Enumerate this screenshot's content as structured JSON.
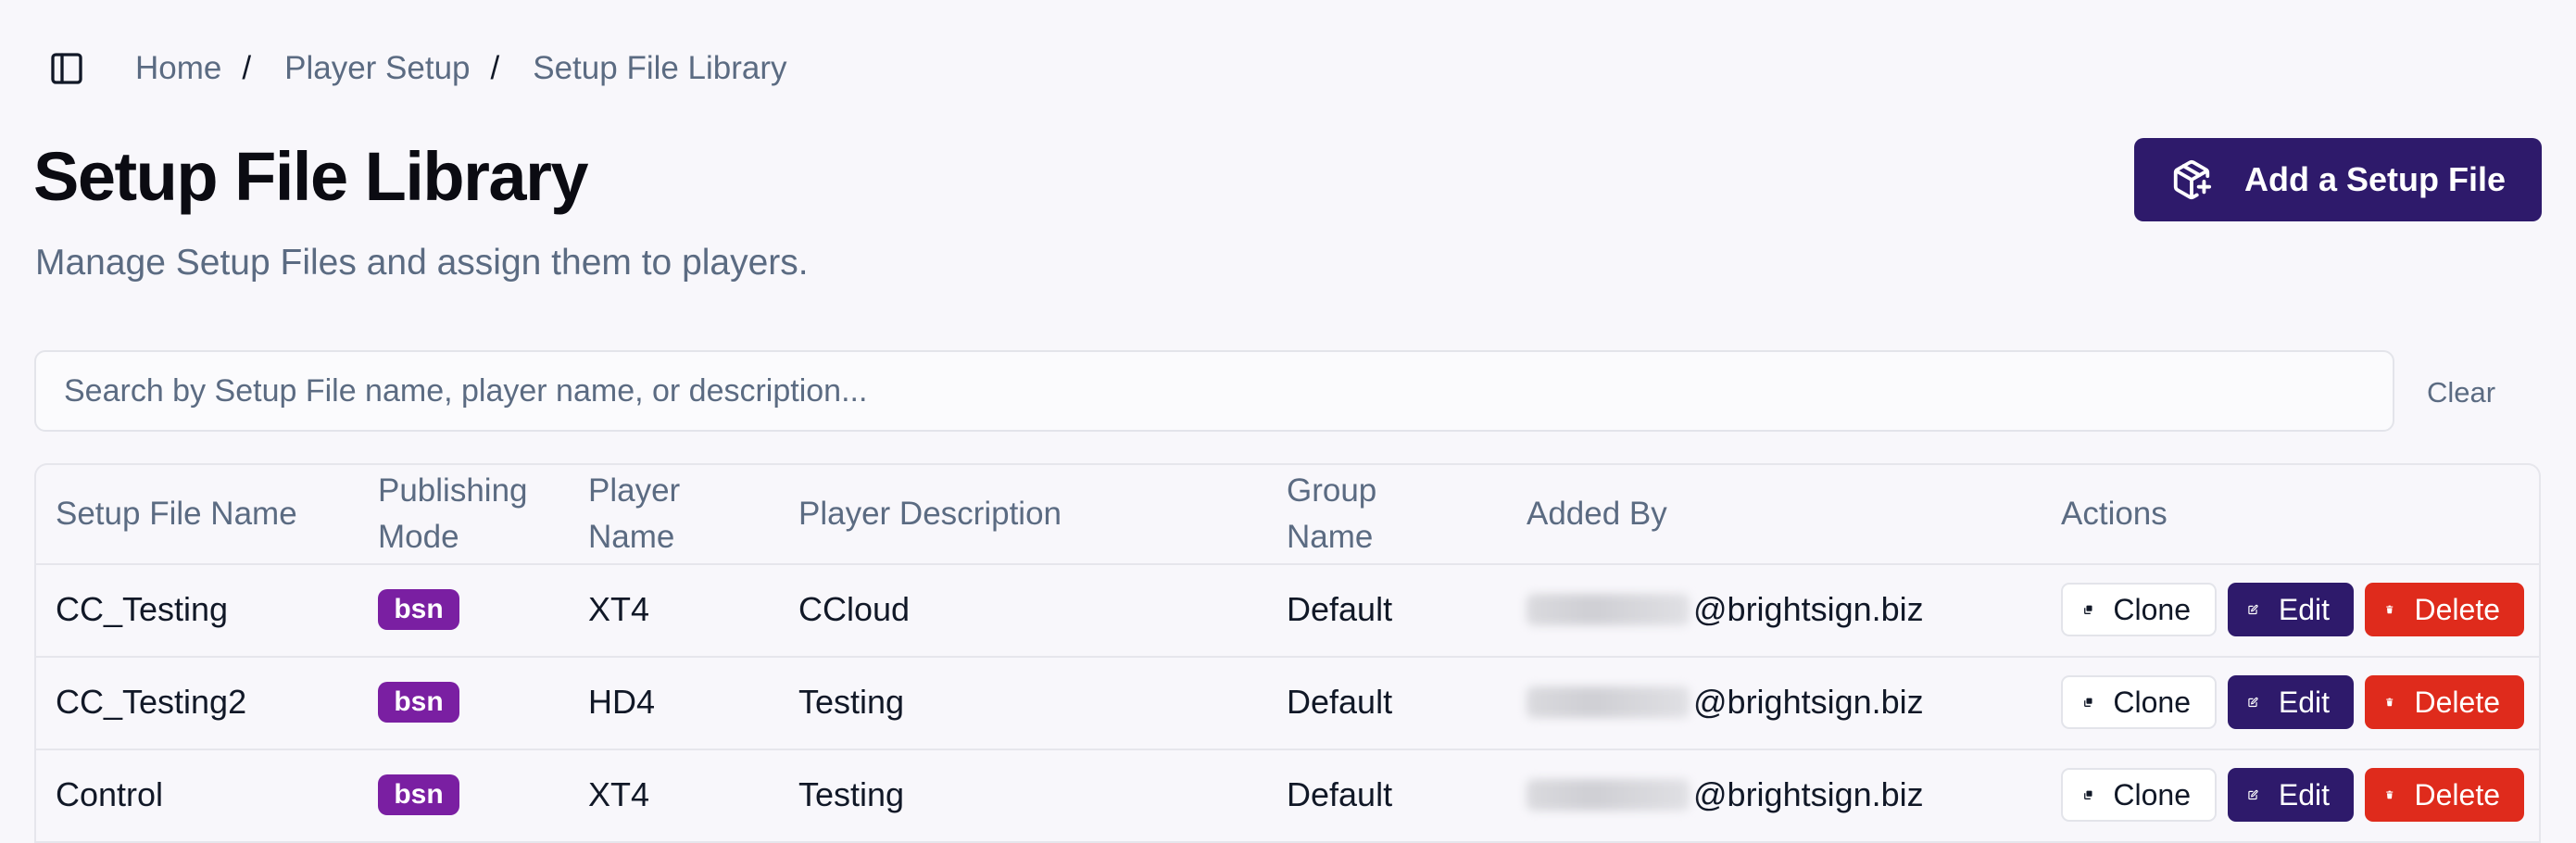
{
  "breadcrumb": {
    "items": [
      "Home",
      "Player Setup"
    ],
    "current": "Setup File Library",
    "separator": "/"
  },
  "header": {
    "title": "Setup File Library",
    "subtitle": "Manage Setup Files and assign them to players.",
    "add_button_label": "Add a Setup File",
    "add_button_icon": "package-plus-icon"
  },
  "search": {
    "placeholder": "Search by Setup File name, player name, or description...",
    "value": "",
    "clear_label": "Clear"
  },
  "table": {
    "columns": [
      {
        "line1": "Setup File Name",
        "line2": ""
      },
      {
        "line1": "Publishing",
        "line2": "Mode"
      },
      {
        "line1": "Player",
        "line2": "Name"
      },
      {
        "line1": "Player Description",
        "line2": ""
      },
      {
        "line1": "Group",
        "line2": "Name"
      },
      {
        "line1": "Added By",
        "line2": ""
      },
      {
        "line1": "Actions",
        "line2": ""
      }
    ],
    "rows": [
      {
        "name": "CC_Testing",
        "mode": "bsn",
        "player": "XT4",
        "description": "CCloud",
        "group": "Default",
        "added_by": "@brightsign.biz"
      },
      {
        "name": "CC_Testing2",
        "mode": "bsn",
        "player": "HD4",
        "description": "Testing",
        "group": "Default",
        "added_by": "@brightsign.biz"
      },
      {
        "name": "Control",
        "mode": "bsn",
        "player": "XT4",
        "description": "Testing",
        "group": "Default",
        "added_by": "@brightsign.biz"
      }
    ],
    "actions": {
      "clone": "Clone",
      "edit": "Edit",
      "delete": "Delete"
    }
  },
  "colors": {
    "primary": "#2e1a6b",
    "danger": "#df2b1c",
    "badge": "#7a1fa2",
    "muted_text": "#5b6b82"
  }
}
